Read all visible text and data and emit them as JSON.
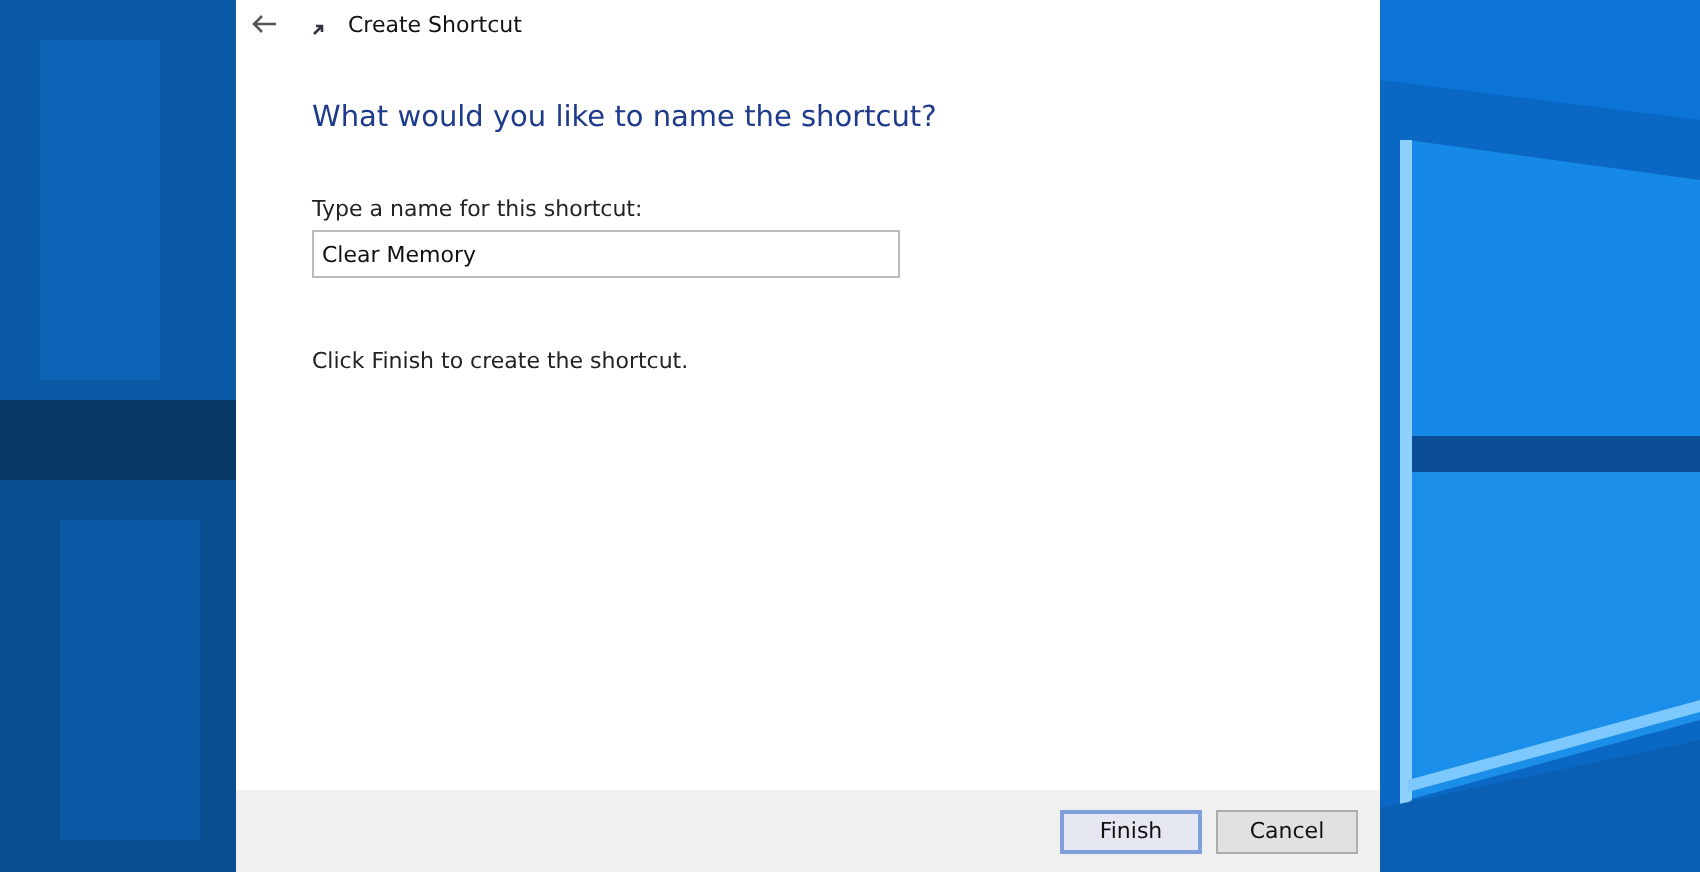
{
  "window": {
    "title": "Create Shortcut"
  },
  "heading": "What would you like to name the shortcut?",
  "name_field": {
    "label": "Type a name for this shortcut:",
    "value": "Clear Memory"
  },
  "instruction": "Click Finish to create the shortcut.",
  "buttons": [
    {
      "label": "Finish",
      "default": true
    },
    {
      "label": "Cancel",
      "default": false
    }
  ]
}
